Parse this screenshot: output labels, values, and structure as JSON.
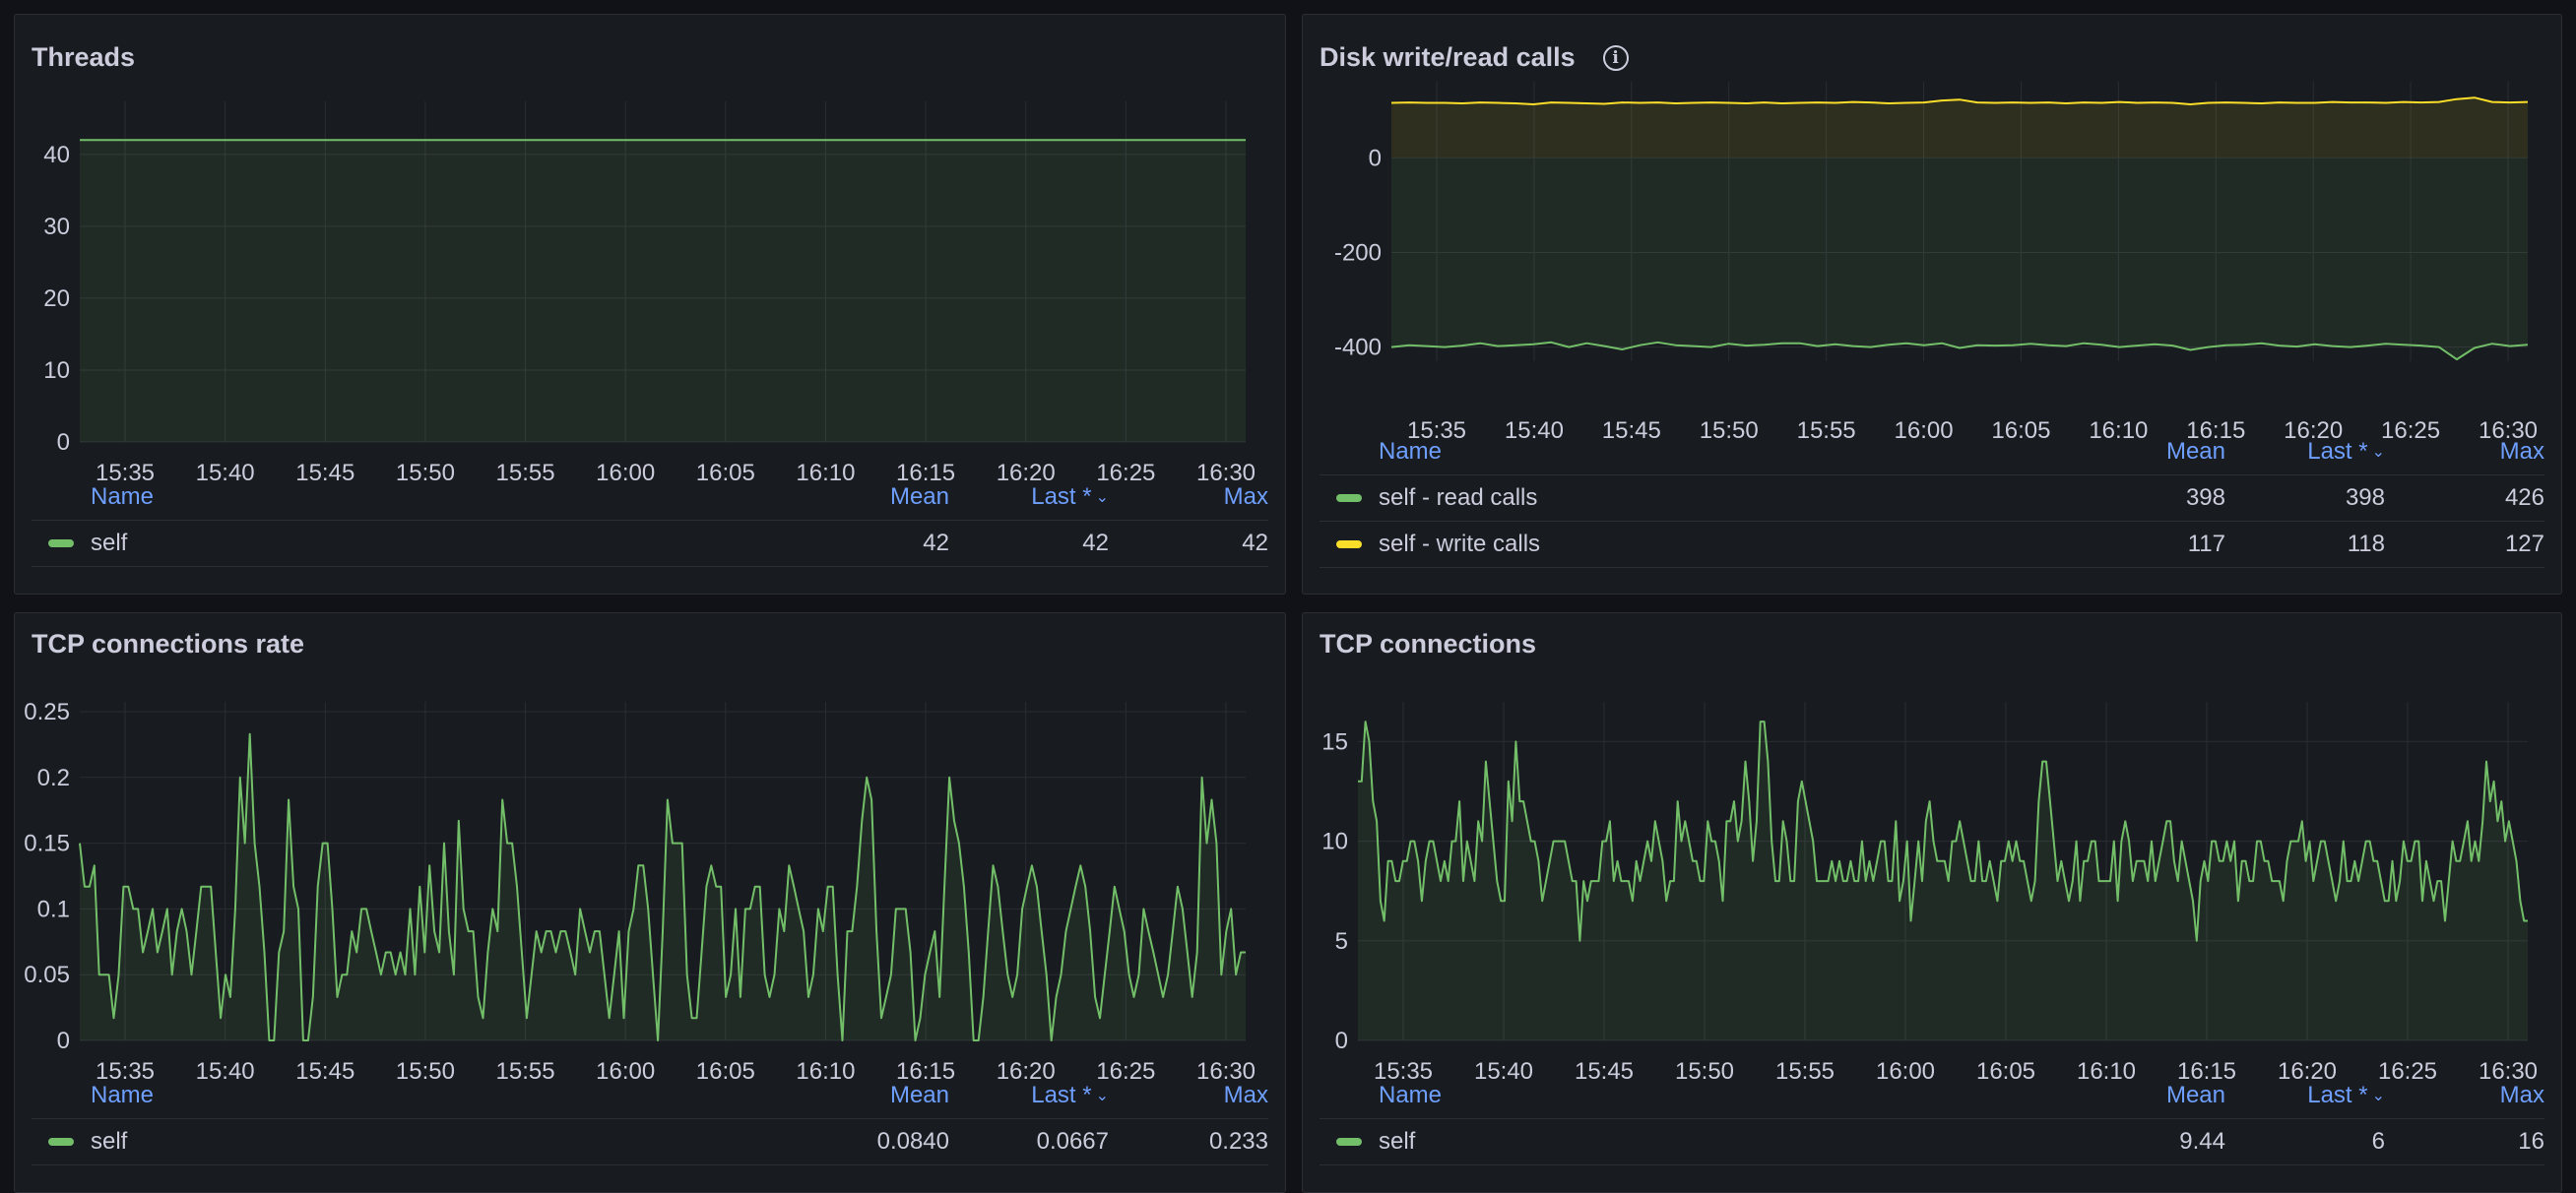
{
  "colors": {
    "green": "#73bf69",
    "yellow": "#fade2a",
    "panel_bg": "#181b1f",
    "header_blue": "#6e9fff"
  },
  "legend_headers": {
    "name": "Name",
    "mean": "Mean",
    "last": "Last *",
    "max": "Max"
  },
  "panels": [
    {
      "title": "Threads",
      "legend": [
        {
          "name": "self",
          "color": "#73bf69",
          "mean": "42",
          "last": "42",
          "max": "42"
        }
      ]
    },
    {
      "title": "Disk write/read calls",
      "info_icon": "info-icon",
      "legend": [
        {
          "name": "self - read calls",
          "color": "#73bf69",
          "mean": "398",
          "last": "398",
          "max": "426"
        },
        {
          "name": "self - write calls",
          "color": "#fade2a",
          "mean": "117",
          "last": "118",
          "max": "127"
        }
      ]
    },
    {
      "title": "TCP connections rate",
      "legend": [
        {
          "name": "self",
          "color": "#73bf69",
          "mean": "0.0840",
          "last": "0.0667",
          "max": "0.233"
        }
      ]
    },
    {
      "title": "TCP connections",
      "legend": [
        {
          "name": "self",
          "color": "#73bf69",
          "mean": "9.44",
          "last": "6",
          "max": "16"
        }
      ]
    }
  ],
  "chart_data": [
    {
      "type": "area",
      "title": "Threads",
      "x_ticks": [
        "15:35",
        "15:40",
        "15:45",
        "15:50",
        "15:55",
        "16:00",
        "16:05",
        "16:10",
        "16:15",
        "16:20",
        "16:25",
        "16:30"
      ],
      "y_ticks": [
        "0",
        "10",
        "20",
        "30",
        "40"
      ],
      "ylim": [
        0,
        46
      ],
      "grid": true,
      "legend_position": "bottom",
      "series": [
        {
          "name": "self",
          "color": "#73bf69",
          "values": [
            42,
            42,
            42,
            42,
            42,
            42,
            42,
            42,
            42,
            42,
            42,
            42,
            42,
            42,
            42,
            42,
            42,
            42,
            42,
            42,
            42,
            42,
            42,
            42,
            42,
            42,
            42,
            42,
            42,
            42,
            42,
            42,
            42,
            42,
            42,
            42,
            42,
            42,
            42,
            42,
            42,
            42,
            42,
            42,
            42,
            42,
            42,
            42,
            42,
            42,
            42,
            42,
            42,
            42,
            42,
            42,
            42,
            42,
            42,
            42,
            42,
            42
          ]
        }
      ]
    },
    {
      "type": "area",
      "title": "Disk write/read calls",
      "x_ticks": [
        "15:35",
        "15:40",
        "15:45",
        "15:50",
        "15:55",
        "16:00",
        "16:05",
        "16:10",
        "16:15",
        "16:20",
        "16:25",
        "16:30"
      ],
      "y_ticks": [
        "0",
        "-200",
        "-400"
      ],
      "ylim": [
        -430,
        140
      ],
      "grid": true,
      "legend_position": "bottom",
      "series": [
        {
          "name": "self - read calls",
          "color": "#73bf69",
          "values": [
            -400,
            -396,
            -398,
            -400,
            -397,
            -392,
            -398,
            -396,
            -394,
            -390,
            -400,
            -392,
            -398,
            -405,
            -396,
            -390,
            -396,
            -398,
            -400,
            -393,
            -397,
            -395,
            -392,
            -392,
            -398,
            -394,
            -398,
            -400,
            -395,
            -392,
            -396,
            -392,
            -402,
            -396,
            -397,
            -396,
            -393,
            -396,
            -398,
            -392,
            -395,
            -400,
            -397,
            -394,
            -397,
            -406,
            -400,
            -396,
            -395,
            -392,
            -397,
            -399,
            -394,
            -398,
            -400,
            -397,
            -393,
            -395,
            -397,
            -400,
            -426,
            -402,
            -393,
            -398,
            -395
          ]
        },
        {
          "name": "self - write calls",
          "color": "#fade2a",
          "values": [
            116,
            117,
            116,
            116,
            115,
            117,
            116,
            115,
            113,
            117,
            116,
            115,
            114,
            117,
            116,
            117,
            115,
            116,
            117,
            116,
            115,
            117,
            115,
            116,
            117,
            116,
            118,
            117,
            115,
            116,
            117,
            121,
            123,
            117,
            116,
            117,
            116,
            117,
            115,
            117,
            116,
            118,
            116,
            117,
            116,
            113,
            116,
            117,
            116,
            115,
            117,
            116,
            116,
            118,
            117,
            117,
            116,
            118,
            117,
            118,
            124,
            127,
            118,
            117,
            118
          ]
        }
      ]
    },
    {
      "type": "area",
      "title": "TCP connections rate",
      "x_ticks": [
        "15:35",
        "15:40",
        "15:45",
        "15:50",
        "15:55",
        "16:00",
        "16:05",
        "16:10",
        "16:15",
        "16:20",
        "16:25",
        "16:30"
      ],
      "y_ticks": [
        "0",
        "0.05",
        "0.1",
        "0.15",
        "0.2",
        "0.25"
      ],
      "ylim": [
        0,
        0.25
      ],
      "grid": true,
      "legend_position": "bottom",
      "series": [
        {
          "name": "self",
          "color": "#73bf69",
          "values": [
            0.15,
            0.117,
            0.117,
            0.133,
            0.05,
            0.05,
            0.05,
            0.017,
            0.05,
            0.117,
            0.117,
            0.1,
            0.1,
            0.067,
            0.083,
            0.1,
            0.067,
            0.083,
            0.1,
            0.05,
            0.083,
            0.1,
            0.083,
            0.05,
            0.083,
            0.117,
            0.117,
            0.117,
            0.067,
            0.017,
            0.05,
            0.033,
            0.1,
            0.2,
            0.15,
            0.233,
            0.15,
            0.117,
            0.067,
            0.0,
            0.0,
            0.067,
            0.083,
            0.183,
            0.117,
            0.1,
            0.0,
            0.0,
            0.033,
            0.117,
            0.15,
            0.15,
            0.1,
            0.033,
            0.05,
            0.05,
            0.083,
            0.067,
            0.1,
            0.1,
            0.083,
            0.067,
            0.05,
            0.067,
            0.067,
            0.05,
            0.067,
            0.05,
            0.1,
            0.05,
            0.117,
            0.067,
            0.133,
            0.083,
            0.067,
            0.15,
            0.083,
            0.05,
            0.167,
            0.1,
            0.083,
            0.083,
            0.033,
            0.017,
            0.067,
            0.1,
            0.083,
            0.183,
            0.15,
            0.15,
            0.117,
            0.067,
            0.017,
            0.05,
            0.083,
            0.067,
            0.083,
            0.083,
            0.067,
            0.083,
            0.083,
            0.067,
            0.05,
            0.1,
            0.083,
            0.067,
            0.083,
            0.083,
            0.05,
            0.017,
            0.05,
            0.083,
            0.017,
            0.083,
            0.1,
            0.133,
            0.133,
            0.1,
            0.05,
            0.0,
            0.083,
            0.183,
            0.15,
            0.15,
            0.15,
            0.05,
            0.017,
            0.017,
            0.067,
            0.117,
            0.133,
            0.117,
            0.117,
            0.033,
            0.05,
            0.1,
            0.033,
            0.1,
            0.1,
            0.117,
            0.117,
            0.05,
            0.033,
            0.05,
            0.1,
            0.083,
            0.133,
            0.117,
            0.1,
            0.083,
            0.033,
            0.05,
            0.1,
            0.083,
            0.117,
            0.117,
            0.05,
            0.0,
            0.083,
            0.083,
            0.117,
            0.167,
            0.2,
            0.183,
            0.083,
            0.017,
            0.033,
            0.05,
            0.1,
            0.1,
            0.1,
            0.067,
            0.0,
            0.017,
            0.05,
            0.067,
            0.083,
            0.033,
            0.117,
            0.2,
            0.167,
            0.15,
            0.117,
            0.067,
            0.0,
            0.0,
            0.033,
            0.083,
            0.133,
            0.117,
            0.083,
            0.05,
            0.033,
            0.05,
            0.1,
            0.117,
            0.133,
            0.117,
            0.083,
            0.05,
            0.0,
            0.033,
            0.05,
            0.083,
            0.1,
            0.117,
            0.133,
            0.117,
            0.083,
            0.033,
            0.017,
            0.05,
            0.083,
            0.117,
            0.1,
            0.083,
            0.05,
            0.033,
            0.05,
            0.1,
            0.083,
            0.067,
            0.05,
            0.033,
            0.05,
            0.083,
            0.117,
            0.1,
            0.067,
            0.033,
            0.067,
            0.2,
            0.15,
            0.183,
            0.15,
            0.05,
            0.083,
            0.1,
            0.05,
            0.067,
            0.067
          ]
        }
      ]
    },
    {
      "type": "area",
      "title": "TCP connections",
      "x_ticks": [
        "15:35",
        "15:40",
        "15:45",
        "15:50",
        "15:55",
        "16:00",
        "16:05",
        "16:10",
        "16:15",
        "16:20",
        "16:25",
        "16:30"
      ],
      "y_ticks": [
        "0",
        "5",
        "10",
        "15"
      ],
      "ylim": [
        0,
        16.5
      ],
      "grid": true,
      "legend_position": "bottom",
      "series": [
        {
          "name": "self",
          "color": "#73bf69",
          "values": [
            13,
            13,
            16,
            15,
            12,
            11,
            7,
            6,
            9,
            9,
            8,
            8,
            9,
            9,
            10,
            10,
            9,
            7,
            9,
            10,
            10,
            9,
            8,
            9,
            8,
            10,
            10,
            12,
            8,
            10,
            9,
            8,
            11,
            10,
            14,
            12,
            10,
            8,
            7,
            7,
            13,
            11,
            15,
            12,
            12,
            11,
            10,
            10,
            9,
            7,
            8,
            9,
            10,
            10,
            10,
            10,
            9,
            8,
            8,
            5,
            8,
            7,
            8,
            8,
            8,
            10,
            10,
            11,
            8,
            9,
            8,
            8,
            8,
            7,
            9,
            8,
            9,
            10,
            9,
            11,
            10,
            9,
            7,
            8,
            8,
            12,
            10,
            11,
            10,
            9,
            9,
            8,
            8,
            11,
            10,
            10,
            9,
            7,
            11,
            11,
            12,
            10,
            11,
            14,
            12,
            9,
            11,
            16,
            16,
            14,
            10,
            8,
            8,
            11,
            10,
            8,
            8,
            12,
            13,
            12,
            11,
            10,
            8,
            8,
            8,
            8,
            9,
            8,
            9,
            8,
            8,
            9,
            8,
            8,
            10,
            8,
            9,
            8,
            9,
            10,
            10,
            8,
            8,
            11,
            7,
            8,
            10,
            6,
            8,
            10,
            8,
            11,
            12,
            10,
            9,
            9,
            9,
            8,
            10,
            10,
            11,
            10,
            9,
            8,
            8,
            10,
            8,
            8,
            9,
            8,
            7,
            9,
            9,
            10,
            9,
            10,
            9,
            9,
            8,
            7,
            8,
            12,
            14,
            14,
            12,
            10,
            8,
            9,
            8,
            7,
            8,
            10,
            7,
            9,
            9,
            10,
            10,
            8,
            8,
            8,
            8,
            10,
            7,
            10,
            11,
            10,
            8,
            9,
            9,
            9,
            8,
            10,
            8,
            9,
            10,
            11,
            11,
            9,
            8,
            10,
            9,
            8,
            7,
            5,
            8,
            9,
            8,
            10,
            10,
            9,
            9,
            10,
            9,
            10,
            7,
            9,
            9,
            8,
            8,
            10,
            10,
            9,
            9,
            8,
            8,
            8,
            7,
            9,
            10,
            10,
            10,
            11,
            9,
            10,
            8,
            9,
            10,
            10,
            9,
            8,
            7,
            8,
            10,
            8,
            8,
            9,
            8,
            9,
            10,
            10,
            9,
            9,
            8,
            7,
            7,
            9,
            7,
            8,
            10,
            9,
            9,
            10,
            10,
            7,
            9,
            8,
            7,
            8,
            8,
            6,
            8,
            10,
            9,
            9,
            10,
            11,
            9,
            10,
            9,
            11,
            14,
            12,
            13,
            11,
            12,
            10,
            11,
            10,
            9,
            7,
            6,
            6
          ]
        }
      ]
    }
  ]
}
